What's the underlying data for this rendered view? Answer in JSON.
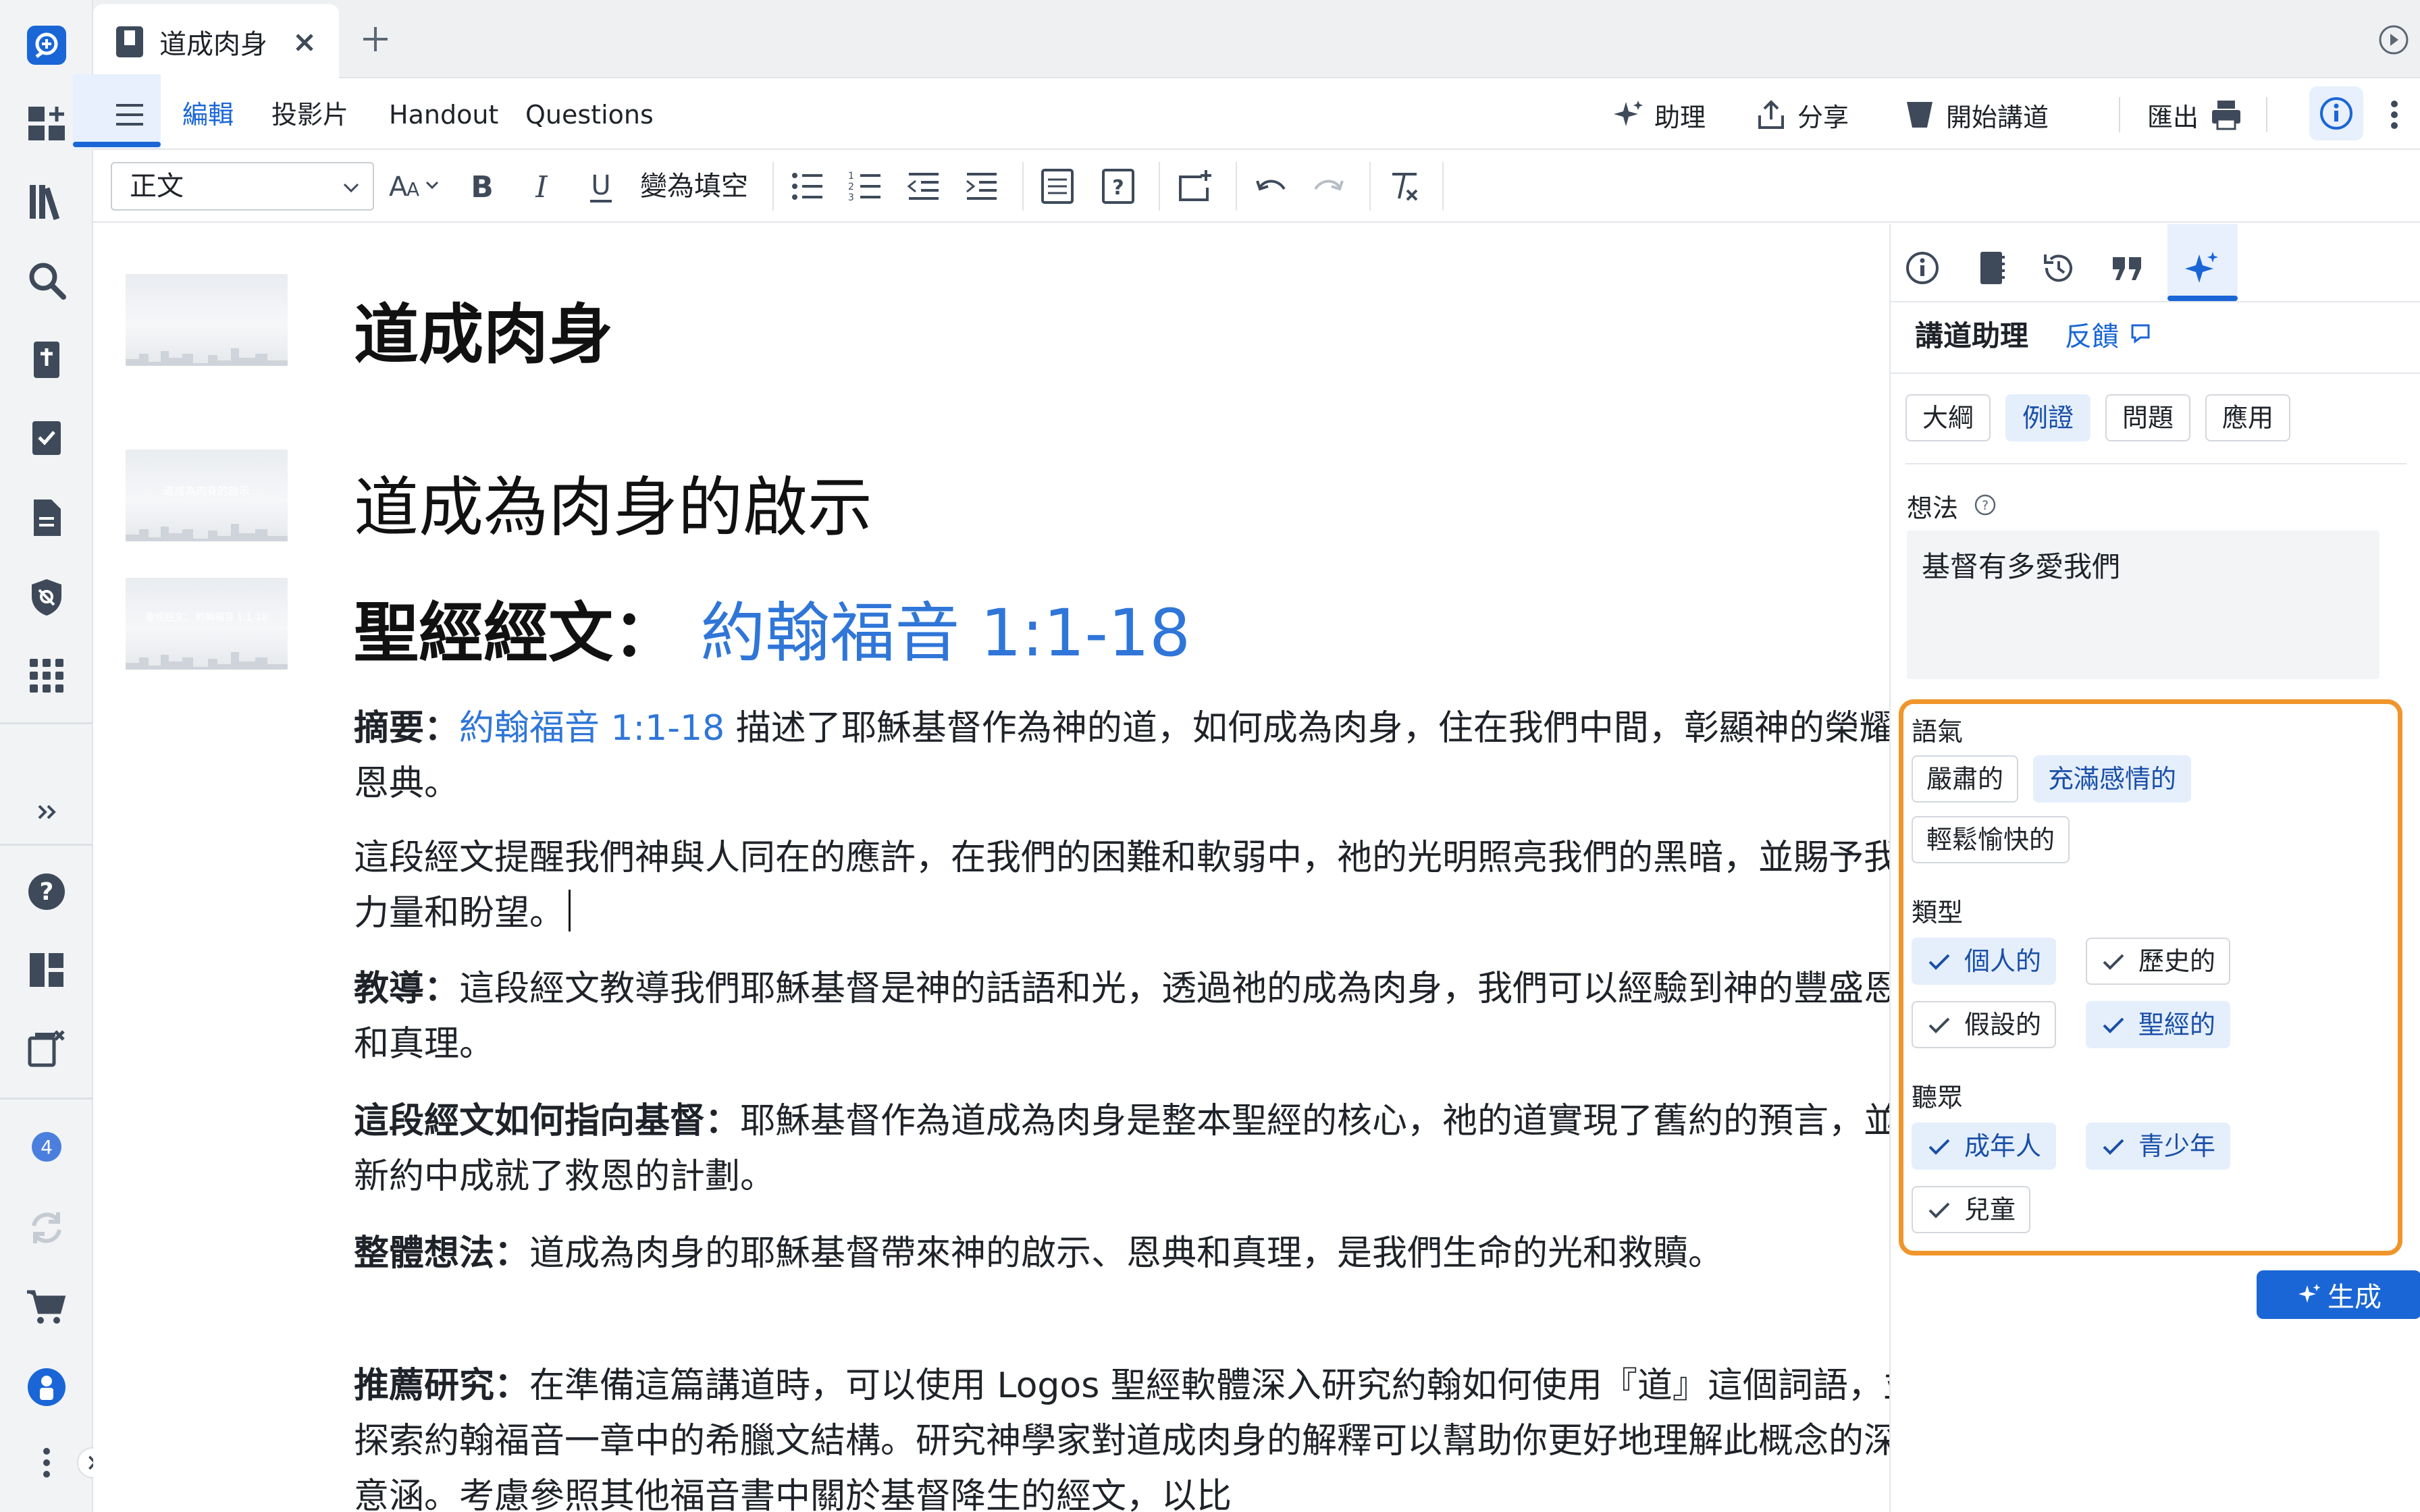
{
  "tab": {
    "title": "道成肉身"
  },
  "toolbar": {
    "modes": [
      "編輯",
      "投影片",
      "Handout",
      "Questions"
    ],
    "assistant_label": "助理",
    "share_label": "分享",
    "preach_label": "開始講道",
    "export_label": "匯出"
  },
  "format": {
    "style_value": "正文",
    "cloze_label": "變為填空"
  },
  "doc": {
    "title": "道成肉身",
    "section": "道成為肉身的啟示",
    "scripture_label": "聖經經文：",
    "scripture_ref": "約翰福音 1:1-18",
    "thumb2_text": "道成為肉身的啟示",
    "thumb3_text": "聖經經文： 約翰福音 1:1-18",
    "summary_label": "摘要：",
    "summary_ref": "約翰福音 1:1-18",
    "summary_text": "描述了耶穌基督作為神的道，如何成為肉身，住在我們中間，彰顯神的榮耀和恩典。",
    "para2": "這段經文提醒我們神與人同在的應許，在我們的困難和軟弱中，祂的光明照亮我們的黑暗，並賜予我們力量和盼望。",
    "teach_label": "教導：",
    "teach_text": "這段經文教導我們耶穌基督是神的話語和光，透過祂的成為肉身，我們可以經驗到神的豐盛恩典和真理。",
    "christ_label": "這段經文如何指向基督：",
    "christ_text": "耶穌基督作為道成為肉身是整本聖經的核心，祂的道實現了舊約的預言，並在新約中成就了救恩的計劃。",
    "big_idea_label": "整體想法：",
    "big_idea_text": "道成為肉身的耶穌基督帶來神的啟示、恩典和真理，是我們生命的光和救贖。",
    "study_label": "推薦研究：",
    "study_text": "在準備這篇講道時，可以使用 Logos 聖經軟體深入研究約翰如何使用『道』這個詞語，並探索約翰福音一章中的希臘文結構。研究神學家對道成肉身的解釋可以幫助你更好地理解此概念的深刻意涵。考慮參照其他福音書中關於基督降生的經文，以比"
  },
  "panel": {
    "title": "講道助理",
    "feedback": "反饋",
    "chips": [
      "大綱",
      "例證",
      "問題",
      "應用"
    ],
    "idea_label": "想法",
    "idea_value": "基督有多愛我們",
    "tone_label": "語氣",
    "tone": [
      "嚴肅的",
      "充滿感情的",
      "輕鬆愉快的"
    ],
    "type_label": "類型",
    "types": [
      "個人的",
      "歷史的",
      "假設的",
      "聖經的"
    ],
    "audience_label": "聽眾",
    "audience": [
      "成年人",
      "青少年",
      "兒童"
    ],
    "generate": "生成"
  },
  "rail": {
    "badge_count": "4"
  },
  "colors": {
    "accent": "#1a66d6",
    "link": "#2f76d8",
    "highlight": "#f0952b"
  }
}
